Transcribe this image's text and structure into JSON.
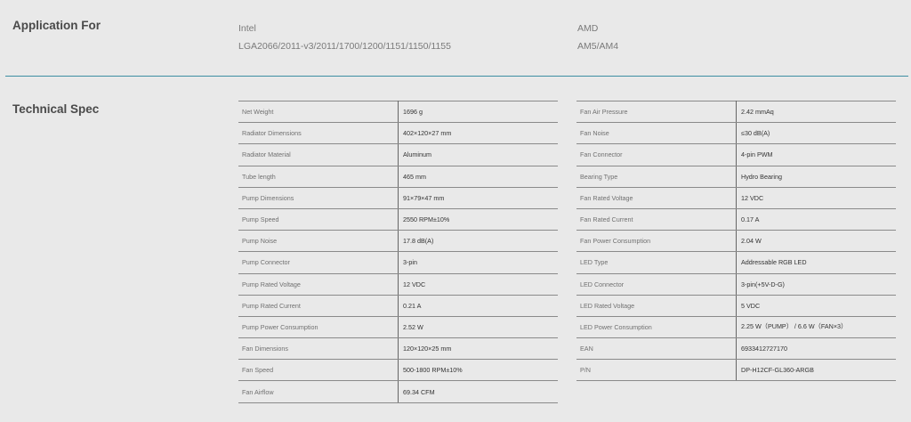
{
  "application": {
    "title": "Application For",
    "intel": {
      "brand": "Intel",
      "sockets": "LGA2066/2011-v3/2011/1700/1200/1151/1150/1155"
    },
    "amd": {
      "brand": "AMD",
      "sockets": "AM5/AM4"
    }
  },
  "spec": {
    "title": "Technical Spec",
    "left": [
      {
        "k": "Net Weight",
        "v": "1696 g"
      },
      {
        "k": "Radiator Dimensions",
        "v": "402×120×27 mm"
      },
      {
        "k": "Radiator Material",
        "v": "Aluminum"
      },
      {
        "k": "Tube length",
        "v": "465 mm"
      },
      {
        "k": "Pump Dimensions",
        "v": "91×79×47 mm"
      },
      {
        "k": "Pump Speed",
        "v": "2550 RPM±10%"
      },
      {
        "k": "Pump Noise",
        "v": "17.8 dB(A)"
      },
      {
        "k": "Pump Connector",
        "v": "3-pin"
      },
      {
        "k": "Pump Rated Voltage",
        "v": "12 VDC"
      },
      {
        "k": "Pump Rated Current",
        "v": "0.21 A"
      },
      {
        "k": "Pump Power Consumption",
        "v": "2.52 W"
      },
      {
        "k": "Fan Dimensions",
        "v": "120×120×25 mm"
      },
      {
        "k": "Fan Speed",
        "v": "500-1800 RPM±10%"
      },
      {
        "k": "Fan Airflow",
        "v": "69.34 CFM"
      }
    ],
    "right": [
      {
        "k": "Fan Air Pressure",
        "v": "2.42 mmAq"
      },
      {
        "k": "Fan Noise",
        "v": "≤30 dB(A)"
      },
      {
        "k": "Fan Connector",
        "v": "4-pin PWM"
      },
      {
        "k": "Bearing Type",
        "v": "Hydro Bearing"
      },
      {
        "k": "Fan Rated Voltage",
        "v": "12 VDC"
      },
      {
        "k": "Fan Rated Current",
        "v": "0.17 A"
      },
      {
        "k": "Fan Power Consumption",
        "v": "2.04 W"
      },
      {
        "k": "LED Type",
        "v": "Addressable RGB LED"
      },
      {
        "k": "LED Connector",
        "v": "3-pin(+5V-D-G)"
      },
      {
        "k": "LED Rated Voltage",
        "v": "5 VDC"
      },
      {
        "k": "LED Power Consumption",
        "v": "2.25 W（PUMP） / 6.6 W（FAN×3）"
      },
      {
        "k": "EAN",
        "v": "6933412727170"
      },
      {
        "k": "P/N",
        "v": "DP-H12CF-GL360-ARGB"
      }
    ]
  }
}
